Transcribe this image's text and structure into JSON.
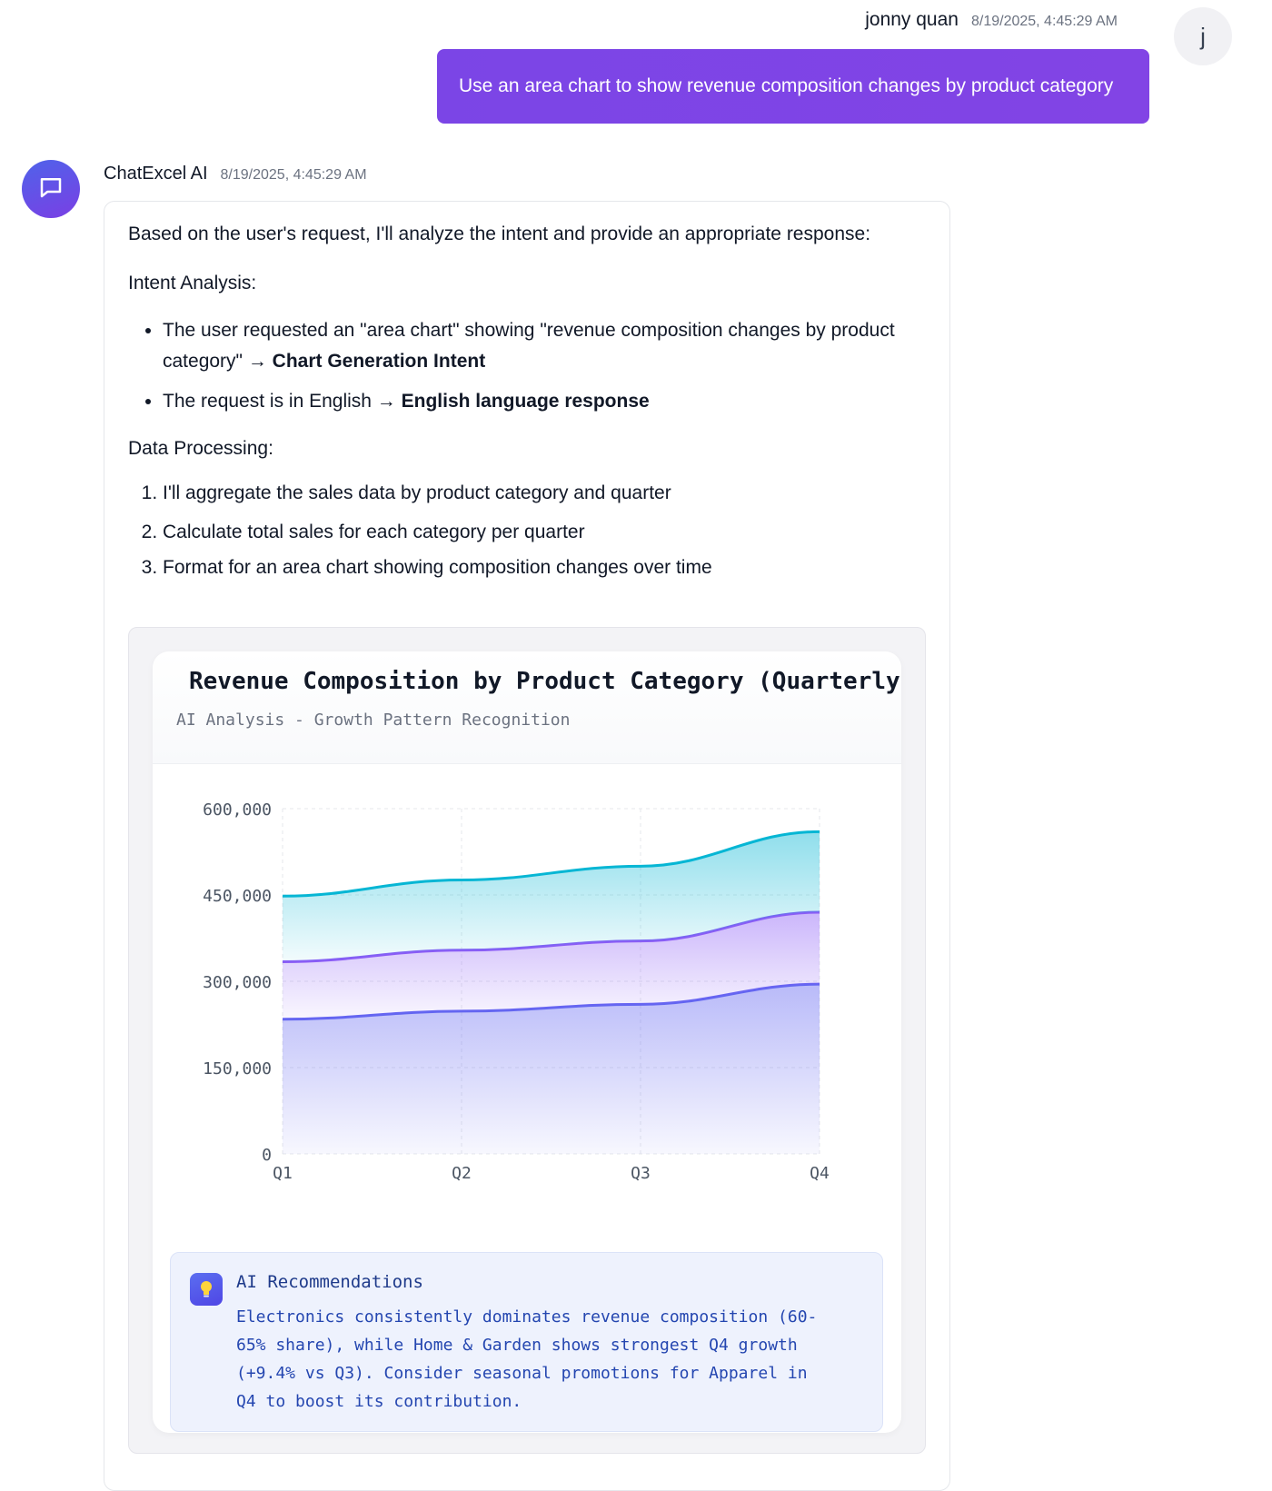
{
  "user_message": {
    "name": "jonny quan",
    "timestamp": "8/19/2025, 4:45:29 AM",
    "avatar_letter": "j",
    "text": "Use an area chart to show revenue composition changes by product category"
  },
  "ai_message": {
    "name": "ChatExcel AI",
    "timestamp": "8/19/2025, 4:45:29 AM",
    "intro": "Based on the user's request, I'll analyze the intent and provide an appropriate response:",
    "intent_heading": "Intent Analysis:",
    "intent_items": [
      {
        "text": "The user requested an \"area chart\" showing \"revenue composition changes by product category\" → ",
        "bold": "Chart Generation Intent"
      },
      {
        "text": "The request is in English → ",
        "bold": "English language response"
      }
    ],
    "processing_heading": "Data Processing:",
    "processing_steps": [
      "I'll aggregate the sales data by product category and quarter",
      "Calculate total sales for each category per quarter",
      "Format for an area chart showing composition changes over time"
    ]
  },
  "chart_card": {
    "title": "Revenue Composition by Product Category (Quarterly)",
    "subtitle": "AI Analysis - Growth Pattern Recognition"
  },
  "chart_data": {
    "type": "area",
    "stacked": true,
    "title": "Revenue Composition by Product Category (Quarterly)",
    "xlabel": "",
    "ylabel": "",
    "categories": [
      "Q1",
      "Q2",
      "Q3",
      "Q4"
    ],
    "ylim": [
      0,
      600000
    ],
    "yticks": [
      0,
      150000,
      300000,
      450000,
      600000
    ],
    "ytick_labels": [
      "0",
      "150,000",
      "300,000",
      "450,000",
      "600,000"
    ],
    "grid": true,
    "legend": "none",
    "series": [
      {
        "color": "#6366f1",
        "values": [
          234000,
          248000,
          260000,
          295000
        ]
      },
      {
        "color": "#8b5cf6",
        "values": [
          100000,
          106000,
          110000,
          125000
        ]
      },
      {
        "color": "#06b6d4",
        "values": [
          114000,
          122000,
          130000,
          140000
        ]
      }
    ]
  },
  "recommendation": {
    "title": "AI Recommendations",
    "text": "Electronics consistently dominates revenue composition (60-65% share), while Home & Garden shows strongest Q4 growth (+9.4% vs Q3). Consider seasonal promotions for Apparel in Q4 to boost its contribution.",
    "icon": "lightbulb-icon"
  },
  "colors": {
    "user_bubble": "#7c3aed",
    "ai_avatar": "#5b5bea",
    "reco_background": "#eef2fd",
    "reco_text": "#2446b0"
  }
}
